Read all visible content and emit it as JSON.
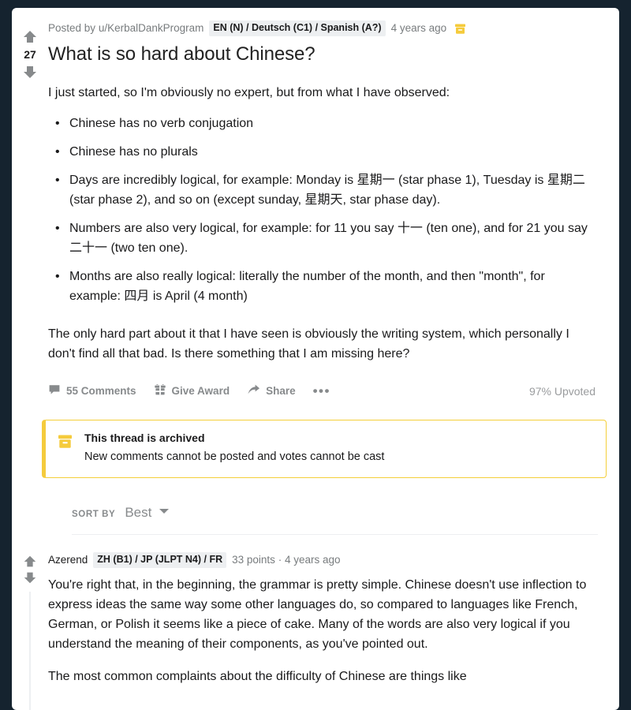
{
  "colors": {
    "page_background": "#15232f",
    "card_background": "#ffffff",
    "accent_yellow": "#f5cb3c",
    "flair_background": "#edeff1",
    "muted_text": "#787c7e"
  },
  "post": {
    "score": "27",
    "upvote_icon": "upvote-arrow-icon",
    "downvote_icon": "downvote-arrow-icon",
    "posted_by_prefix": "Posted by",
    "author": "u/KerbalDankProgram",
    "author_flair": "EN (N) / Deutsch (C1) / Spanish (A?)",
    "timestamp": "4 years ago",
    "archived_icon": "archive-box-icon",
    "title": "What is so hard about Chinese?",
    "intro": "I just started, so I'm obviously no expert, but from what I have observed:",
    "bullets": [
      "Chinese has no verb conjugation",
      "Chinese has no plurals",
      "Days are incredibly logical, for example: Monday is 星期一 (star phase 1), Tuesday is 星期二 (star phase 2), and so on (except sunday, 星期天, star phase day).",
      "Numbers are also very logical, for example: for 11 you say 十一 (ten one), and for 21 you say 二十一 (two ten one).",
      "Months are also really logical: literally the number of the month, and then \"month\", for example: 四月 is April (4 month)"
    ],
    "closing": "The only hard part about it that I have seen is obviously the writing system, which personally I don't find all that bad. Is there something that I am missing here?"
  },
  "actions": {
    "comments_label": "55 Comments",
    "comments_icon": "comment-bubble-icon",
    "give_award_label": "Give Award",
    "give_award_icon": "gift-icon",
    "share_label": "Share",
    "share_icon": "share-arrow-icon",
    "more_label": "•••",
    "more_icon": "more-options-icon",
    "upvoted_percent": "97% Upvoted"
  },
  "archive_banner": {
    "icon": "archive-box-icon",
    "title": "This thread is archived",
    "subtitle": "New comments cannot be posted and votes cannot be cast"
  },
  "sort": {
    "label": "SORT BY",
    "value": "Best",
    "caret_icon": "chevron-down-icon",
    "options": [
      "Best"
    ]
  },
  "comments": [
    {
      "author": "Azerend",
      "flair": "ZH (B1) / JP (JLPT N4) / FR",
      "points": "33 points",
      "separator": "·",
      "timestamp": "4 years ago",
      "upvote_icon": "upvote-arrow-icon",
      "downvote_icon": "downvote-arrow-icon",
      "paragraphs": [
        "You're right that, in the beginning, the grammar is pretty simple. Chinese doesn't use inflection to express ideas the same way some other languages do, so compared to languages like French, German, or Polish it seems like a piece of cake. Many of the words are also very logical if you understand the meaning of their components, as you've pointed out.",
        "The most common complaints about the difficulty of Chinese are things like"
      ]
    }
  ]
}
